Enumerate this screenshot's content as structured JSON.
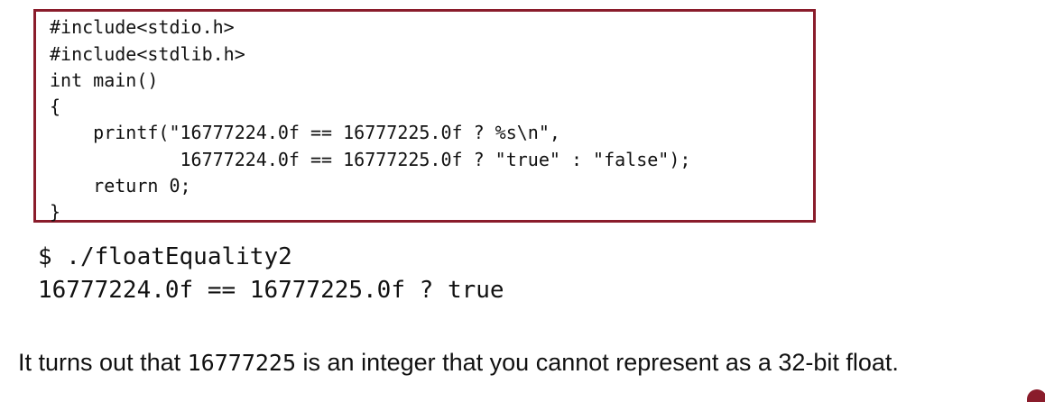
{
  "code": {
    "border_color": "#8a1c2b",
    "lines": [
      "#include<stdio.h>",
      "#include<stdlib.h>",
      "int main()",
      "{",
      "    printf(\"16777224.0f == 16777225.0f ? %s\\n\",",
      "            16777224.0f == 16777225.0f ? \"true\" : \"false\");",
      "    return 0;",
      "}"
    ]
  },
  "terminal": {
    "command": "$ ./floatEquality2",
    "output": "16777224.0f == 16777225.0f ? true"
  },
  "explanation": {
    "before": "It turns out that ",
    "number": "16777225",
    "after": " is an integer that you cannot represent as a 32-bit float."
  }
}
